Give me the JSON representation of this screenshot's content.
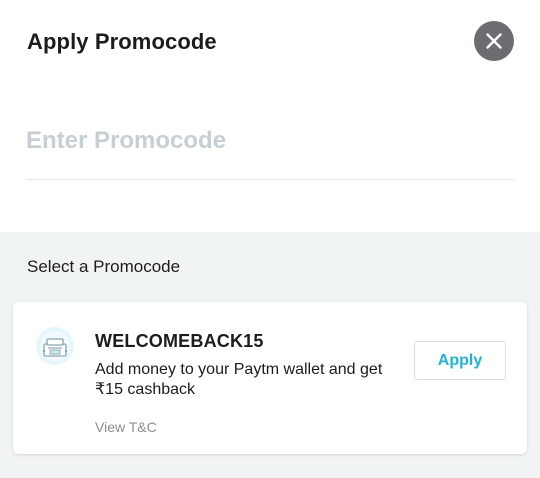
{
  "header": {
    "title": "Apply Promocode",
    "close_icon": "close-icon"
  },
  "promo_input": {
    "placeholder": "Enter Promocode",
    "value": ""
  },
  "promos_section": {
    "title": "Select a Promocode",
    "items": [
      {
        "icon": "wallet-icon",
        "code": "WELCOMEBACK15",
        "description": "Add money to your Paytm wallet and get ₹15 cashback",
        "tnc_label": "View T&C",
        "apply_label": "Apply"
      }
    ]
  },
  "colors": {
    "accent": "#21b2d6",
    "close_bg": "#6b6d70",
    "section_bg": "#f1f4f5",
    "placeholder": "#c7cfd5"
  }
}
